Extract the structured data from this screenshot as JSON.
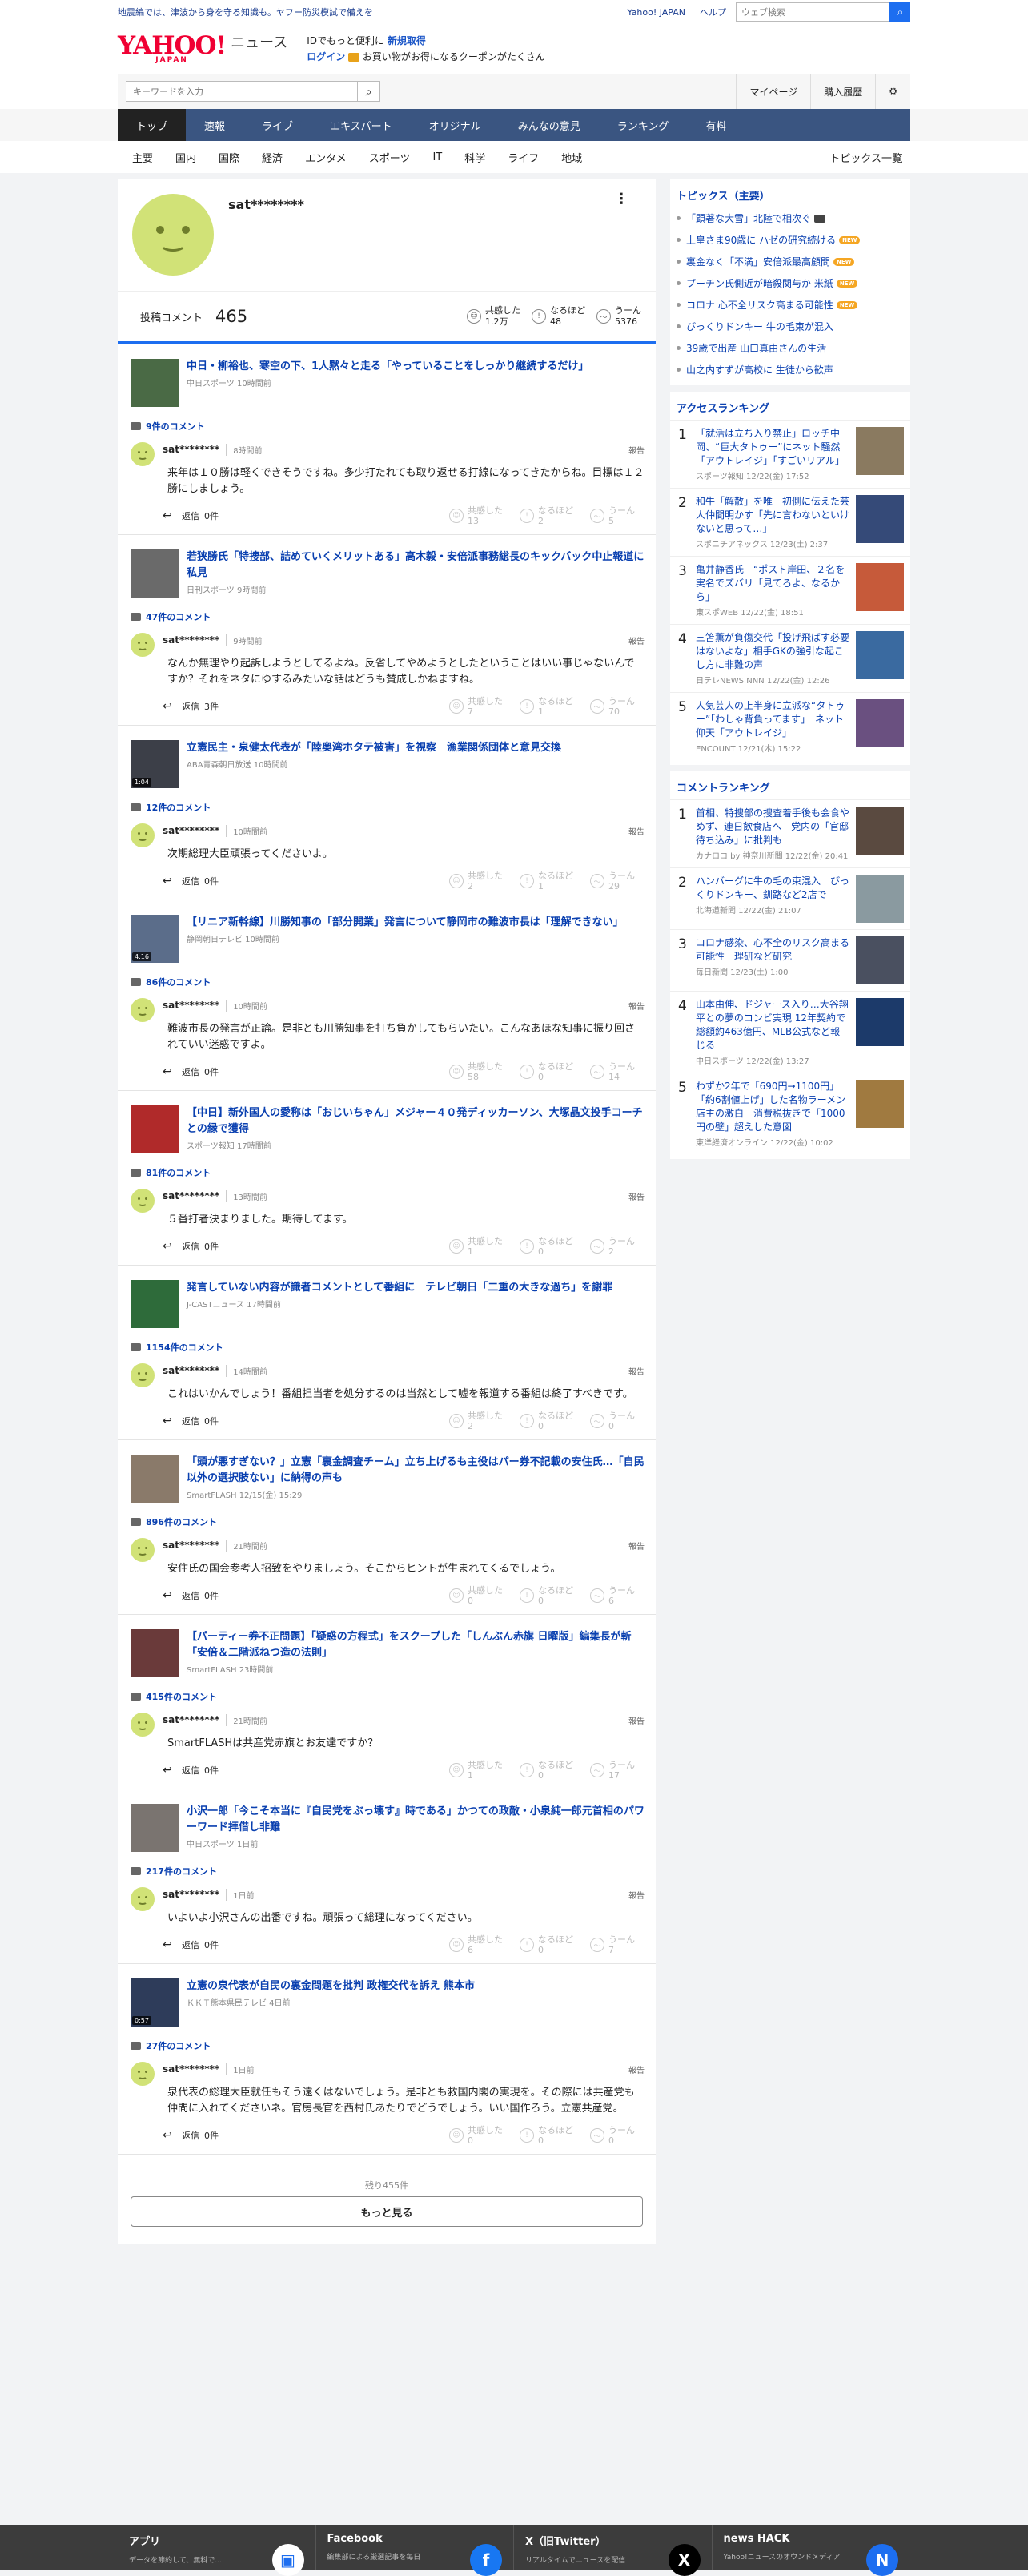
{
  "topbar": {
    "notice": "地震編では、津波から身を守る知識も。ヤフー防災模試で備えを",
    "yahoo_japan": "Yahoo! JAPAN",
    "help": "ヘルプ",
    "search_placeholder": "ウェブ検索"
  },
  "masthead": {
    "logo_text": "YAHOO!",
    "logo_sub": "JAPAN",
    "section": "ニュース",
    "promo1_prefix": "IDでもっと便利に",
    "promo1_link": "新規取得",
    "promo2_link": "ログイン",
    "promo2_suffix": "お買い物がお得になるクーポンがたくさん"
  },
  "search": {
    "placeholder": "キーワードを入力",
    "mypage": "マイページ",
    "history": "購入履歴"
  },
  "gnav": [
    "トップ",
    "速報",
    "ライブ",
    "エキスパート",
    "オリジナル",
    "みんなの意見",
    "ランキング",
    "有料"
  ],
  "snav": {
    "items": [
      "主要",
      "国内",
      "国際",
      "経済",
      "エンタメ",
      "スポーツ",
      "IT",
      "科学",
      "ライフ",
      "地域"
    ],
    "more": "トピックス一覧"
  },
  "profile": {
    "name": "sat********",
    "posted_label": "投稿コメント",
    "posted_count": "465",
    "reactions": [
      {
        "label": "共感した",
        "value": "1.2万",
        "icon": "smile"
      },
      {
        "label": "なるほど",
        "value": "48",
        "icon": "bulb"
      },
      {
        "label": "うーん",
        "value": "5376",
        "icon": "meh"
      }
    ]
  },
  "ui": {
    "comments_suffix": "件のコメント",
    "report": "報告",
    "reply_prefix": "返信",
    "vote_labels": [
      "共感した",
      "なるほど",
      "うーん"
    ]
  },
  "entries": [
    {
      "title": "中日・柳裕也、寒空の下、1人黙々と走る「やっていることをしっかり継続するだけ」",
      "source": "中日スポーツ 10時間前",
      "count": "9",
      "user": "sat********",
      "time": "8時間前",
      "text": "来年は１０勝は軽くできそうですね。多少打たれても取り返せる打線になってきたからね。目標は１２勝にしましょう。",
      "replies": "0件",
      "votes": [
        "13",
        "2",
        "5"
      ],
      "video": "",
      "thumb": "#4a6a45"
    },
    {
      "title": "若狭勝氏「特捜部、詰めていくメリットある」高木毅・安倍派事務総長のキックバック中止報道に私見",
      "source": "日刊スポーツ 9時間前",
      "count": "47",
      "user": "sat********",
      "time": "9時間前",
      "text": "なんか無理やり起訴しようとしてるよね。反省してやめようとしたということはいい事じゃないんですか？それをネタにゆするみたいな話はどうも賛成しかねますね。",
      "replies": "3件",
      "votes": [
        "7",
        "1",
        "70"
      ],
      "video": "",
      "thumb": "#6a6a6a"
    },
    {
      "title": "立憲民主・泉健太代表が「陸奥湾ホタテ被害」を視察　漁業関係団体と意見交換",
      "source": "ABA青森朝日放送 10時間前",
      "count": "12",
      "user": "sat********",
      "time": "10時間前",
      "text": "次期総理大臣頑張ってくださいよ。",
      "replies": "0件",
      "votes": [
        "2",
        "1",
        "29"
      ],
      "video": "1:04",
      "thumb": "#3c3f48"
    },
    {
      "title": "【リニア新幹線】川勝知事の「部分開業」発言について静岡市の難波市長は「理解できない」",
      "source": "静岡朝日テレビ 10時間前",
      "count": "86",
      "user": "sat********",
      "time": "10時間前",
      "text": "難波市長の発言が正論。是非とも川勝知事を打ち負かしてもらいたい。こんなあほな知事に振り回されていい迷惑ですよ。",
      "replies": "0件",
      "votes": [
        "58",
        "0",
        "14"
      ],
      "video": "4:16",
      "thumb": "#5b6d8a"
    },
    {
      "title": "【中日】新外国人の愛称は「おじいちゃん」メジャー４０発ディッカーソン、大塚晶文投手コーチとの縁で獲得",
      "source": "スポーツ報知 17時間前",
      "count": "81",
      "user": "sat********",
      "time": "13時間前",
      "text": "５番打者決まりました。期待してます。",
      "replies": "0件",
      "votes": [
        "1",
        "0",
        "2"
      ],
      "video": "",
      "thumb": "#b02a2a"
    },
    {
      "title": "発言していない内容が識者コメントとして番組に　テレビ朝日「二重の大きな過ち」を謝罪",
      "source": "J-CASTニュース 17時間前",
      "count": "1154",
      "user": "sat********",
      "time": "14時間前",
      "text": "これはいかんでしょう！番組担当者を処分するのは当然として嘘を報道する番組は終了すべきです。",
      "replies": "0件",
      "votes": [
        "2",
        "0",
        "0"
      ],
      "video": "",
      "thumb": "#2e6b3a"
    },
    {
      "title": "「頭が悪すぎない？」立憲「裏金調査チーム」立ち上げるも主役はパー券不記載の安住氏…「自民以外の選択肢ない」に納得の声も",
      "source": "SmartFLASH 12/15(金) 15:29",
      "count": "896",
      "user": "sat********",
      "time": "21時間前",
      "text": "安住氏の国会参考人招致をやりましょう。そこからヒントが生まれてくるでしょう。",
      "replies": "0件",
      "votes": [
        "0",
        "0",
        "6"
      ],
      "video": "",
      "thumb": "#8a7a6a"
    },
    {
      "title": "【パーティー券不正問題】「疑惑の方程式」をスクープした「しんぶん赤旗 日曜版」編集長が斬「安倍＆二階派ねつ造の法則」",
      "source": "SmartFLASH 23時間前",
      "count": "415",
      "user": "sat********",
      "time": "21時間前",
      "text": "SmartFLASHは共産党赤旗とお友達ですか？",
      "replies": "0件",
      "votes": [
        "1",
        "0",
        "17"
      ],
      "video": "",
      "thumb": "#6a3a3a"
    },
    {
      "title": "小沢一郎「今こそ本当に『自民党をぶっ壊す』時である」かつての政敵・小泉純一郎元首相のパワーワード拝借し非難",
      "source": "中日スポーツ 1日前",
      "count": "217",
      "user": "sat********",
      "time": "1日前",
      "text": "いよいよ小沢さんの出番ですね。頑張って総理になってください。",
      "replies": "0件",
      "votes": [
        "6",
        "0",
        "7"
      ],
      "video": "",
      "thumb": "#7a7470"
    },
    {
      "title": "立憲の泉代表が自民の裏金問題を批判 政権交代を訴え 熊本市",
      "source": "ＫＫＴ熊本県民テレビ 4日前",
      "count": "27",
      "user": "sat********",
      "time": "1日前",
      "text": "泉代表の総理大臣就任もそう遠くはないでしょう。是非とも救国内閣の実現を。その際には共産党も仲間に入れてくださいネ。官房長官を西村氏あたりでどうでしょう。いい国作ろう。立憲共産党。",
      "replies": "0件",
      "votes": [
        "0",
        "0",
        "0"
      ],
      "video": "0:57",
      "thumb": "#2e3c5a"
    }
  ],
  "more": {
    "remaining": "残り455件",
    "button": "もっと見る"
  },
  "side": {
    "topics_title": "トピックス（主要）",
    "topics": [
      {
        "text": "「顕著な大雪」北陸で相次ぐ",
        "badge": "cam"
      },
      {
        "text": "上皇さま90歳に ハゼの研究続ける",
        "badge": "new"
      },
      {
        "text": "裏金なく「不満」安倍派最高顧問",
        "badge": "new"
      },
      {
        "text": "プーチン氏側近が暗殺関与か 米紙",
        "badge": "new"
      },
      {
        "text": "コロナ 心不全リスク高まる可能性",
        "badge": "new"
      },
      {
        "text": "びっくりドンキー 牛の毛束が混入",
        "badge": ""
      },
      {
        "text": "39歳で出産 山口真由さんの生活",
        "badge": ""
      },
      {
        "text": "山之内すずが高校に 生徒から歓声",
        "badge": ""
      }
    ],
    "new_label": "NEW",
    "access_title": "アクセスランキング",
    "access": [
      {
        "no": "1",
        "title": "「就活は立ち入り禁止」ロッチ中岡、“巨大タトゥー”にネット騒然「アウトレイジ」「すごいリアル」",
        "src": "スポーツ報知 12/22(金) 17:52",
        "thumb": "#8a7a60"
      },
      {
        "no": "2",
        "title": "和牛「解散」を唯一初側に伝えた芸人仲間明かす「先に言わないといけないと思って…」",
        "src": "スポニチアネックス 12/23(土) 2:37",
        "thumb": "#354a78"
      },
      {
        "no": "3",
        "title": "亀井静香氏　“ポスト岸田、２名を実名でズバリ「見てろよ、なるから」",
        "src": "東スポWEB 12/22(金) 18:51",
        "thumb": "#c65a3a"
      },
      {
        "no": "4",
        "title": "三笘薫が負傷交代「投げ飛ばす必要はないよな」相手GKの強引な起こし方に非難の声",
        "src": "日テレNEWS NNN 12/22(金) 12:26",
        "thumb": "#3a6aa0"
      },
      {
        "no": "5",
        "title": "人気芸人の上半身に立派な“タトゥー”「わしゃ背負ってます」　ネット仰天「アウトレイジ」",
        "src": "ENCOUNT 12/21(木) 15:22",
        "thumb": "#6a5080"
      }
    ],
    "comment_title": "コメントランキング",
    "comments": [
      {
        "no": "1",
        "title": "首相、特捜部の捜査着手後も会食やめず、連日飲食店へ　党内の「官邸待ち込み」に批判も",
        "src": "カナロコ by 神奈川新聞 12/22(金) 20:41",
        "thumb": "#5a4a40"
      },
      {
        "no": "2",
        "title": "ハンバーグに牛の毛の束混入　びっくりドンキー、釧路など2店で",
        "src": "北海道新聞 12/22(金) 21:07",
        "thumb": "#8a9aa0"
      },
      {
        "no": "3",
        "title": "コロナ感染、心不全のリスク高まる可能性　理研など研究",
        "src": "毎日新聞 12/23(土) 1:00",
        "thumb": "#4a5060"
      },
      {
        "no": "4",
        "title": "山本由伸、ドジャース入り…大谷翔平との夢のコンビ実現 12年契約で総額約463億円、MLB公式など報じる",
        "src": "中日スポーツ 12/22(金) 13:27",
        "thumb": "#1c3a6a"
      },
      {
        "no": "5",
        "title": "わずか2年で「690円→1100円」「約6割値上げ」した名物ラーメン店主の激白　消費税抜きで「1000円の壁」超えした意図",
        "src": "東洋経済オンライン 12/22(金) 10:02",
        "thumb": "#a07a40"
      }
    ]
  },
  "footer": [
    {
      "title": "アプリ",
      "sub": "データを節約して、無料で...",
      "icon": "app"
    },
    {
      "title": "Facebook",
      "sub": "編集部による厳選記事を毎日",
      "icon": "f"
    },
    {
      "title": "X（旧Twitter）",
      "sub": "リアルタイムでニュースを配信",
      "icon": "X"
    },
    {
      "title": "news HACK",
      "sub": "Yahoo!ニュースのオウンドメディア",
      "icon": "N"
    }
  ],
  "colors": {
    "brand": "#f00033",
    "nav": "#3a5581",
    "link": "#0a40b0",
    "accent": "#1d6ef0",
    "avatar": "#d1e277"
  }
}
